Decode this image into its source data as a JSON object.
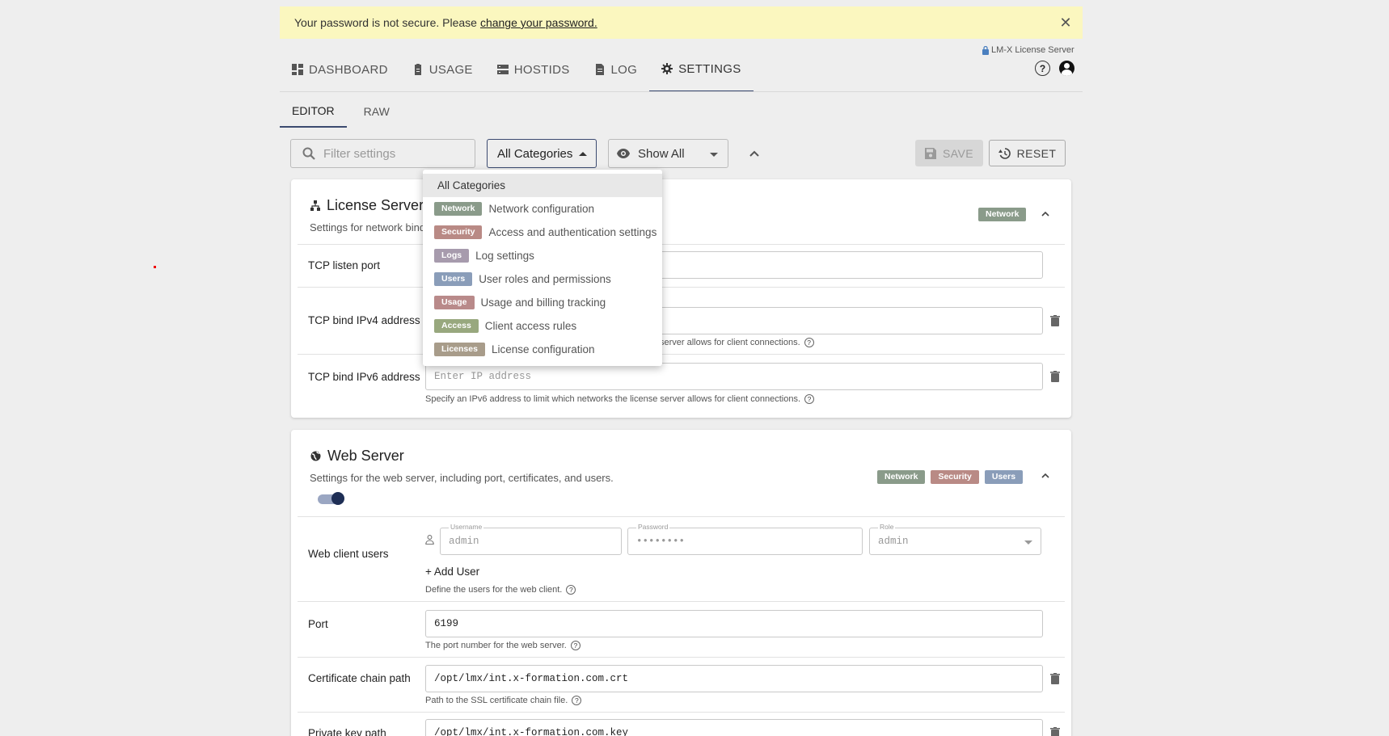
{
  "banner": {
    "text": "Your password is not secure. Please",
    "link": "change your password."
  },
  "nav": {
    "tabs": [
      {
        "label": "DASHBOARD",
        "icon": "dashboard-icon"
      },
      {
        "label": "USAGE",
        "icon": "clipboard-icon"
      },
      {
        "label": "HOSTIDS",
        "icon": "server-icon"
      },
      {
        "label": "LOG",
        "icon": "file-icon"
      },
      {
        "label": "SETTINGS",
        "icon": "gear-icon"
      }
    ],
    "active": "SETTINGS"
  },
  "brand": {
    "name": "LM-X License Server"
  },
  "subtabs": [
    {
      "label": "EDITOR"
    },
    {
      "label": "RAW"
    }
  ],
  "toolbar": {
    "filter_placeholder": "Filter settings",
    "category_value": "All Categories",
    "show_value": "Show All",
    "save_label": "SAVE",
    "reset_label": "RESET"
  },
  "dropdown": {
    "selected": "All Categories",
    "items": [
      {
        "badge": "Network",
        "color": "#8a9b8a",
        "label": "Network configuration"
      },
      {
        "badge": "Security",
        "color": "#b98a85",
        "label": "Access and authentication settings"
      },
      {
        "badge": "Logs",
        "color": "#a79bad",
        "label": "Log settings"
      },
      {
        "badge": "Users",
        "color": "#8a9db9",
        "label": "User roles and permissions"
      },
      {
        "badge": "Usage",
        "color": "#b98a8a",
        "label": "Usage and billing tracking"
      },
      {
        "badge": "Access",
        "color": "#98a87e",
        "label": "Client access rules"
      },
      {
        "badge": "Licenses",
        "color": "#a89c8a",
        "label": "License configuration"
      }
    ]
  },
  "license_server": {
    "title": "License Server",
    "desc": "Settings for network bind",
    "badge": "Network",
    "rows": [
      {
        "label": "TCP listen port",
        "value": ""
      },
      {
        "label": "TCP bind IPv4 address",
        "value": "",
        "hint": "server allows for client connections."
      },
      {
        "label": "TCP bind IPv6 address",
        "placeholder": "Enter IP address",
        "hint": "Specify an IPv6 address to limit which networks the license server allows for client connections."
      }
    ]
  },
  "web_server": {
    "title": "Web Server",
    "desc": "Settings for the web server, including port, certificates, and users.",
    "badges": [
      {
        "label": "Network",
        "color": "#8a9b8a"
      },
      {
        "label": "Security",
        "color": "#b98a85"
      },
      {
        "label": "Users",
        "color": "#8a9db9"
      }
    ],
    "users_label": "Web client users",
    "username_label": "Username",
    "username": "admin",
    "password_label": "Password",
    "password": "••••••••",
    "role_label": "Role",
    "role": "admin",
    "add_user": "+ Add User",
    "users_hint": "Define the users for the web client.",
    "port_label": "Port",
    "port": "6199",
    "port_hint": "The port number for the web server.",
    "cert_label": "Certificate chain path",
    "cert": "/opt/lmx/int.x-formation.com.crt",
    "cert_hint": "Path to the SSL certificate chain file.",
    "key_label": "Private key path",
    "key": "/opt/lmx/int.x-formation.com.key"
  }
}
